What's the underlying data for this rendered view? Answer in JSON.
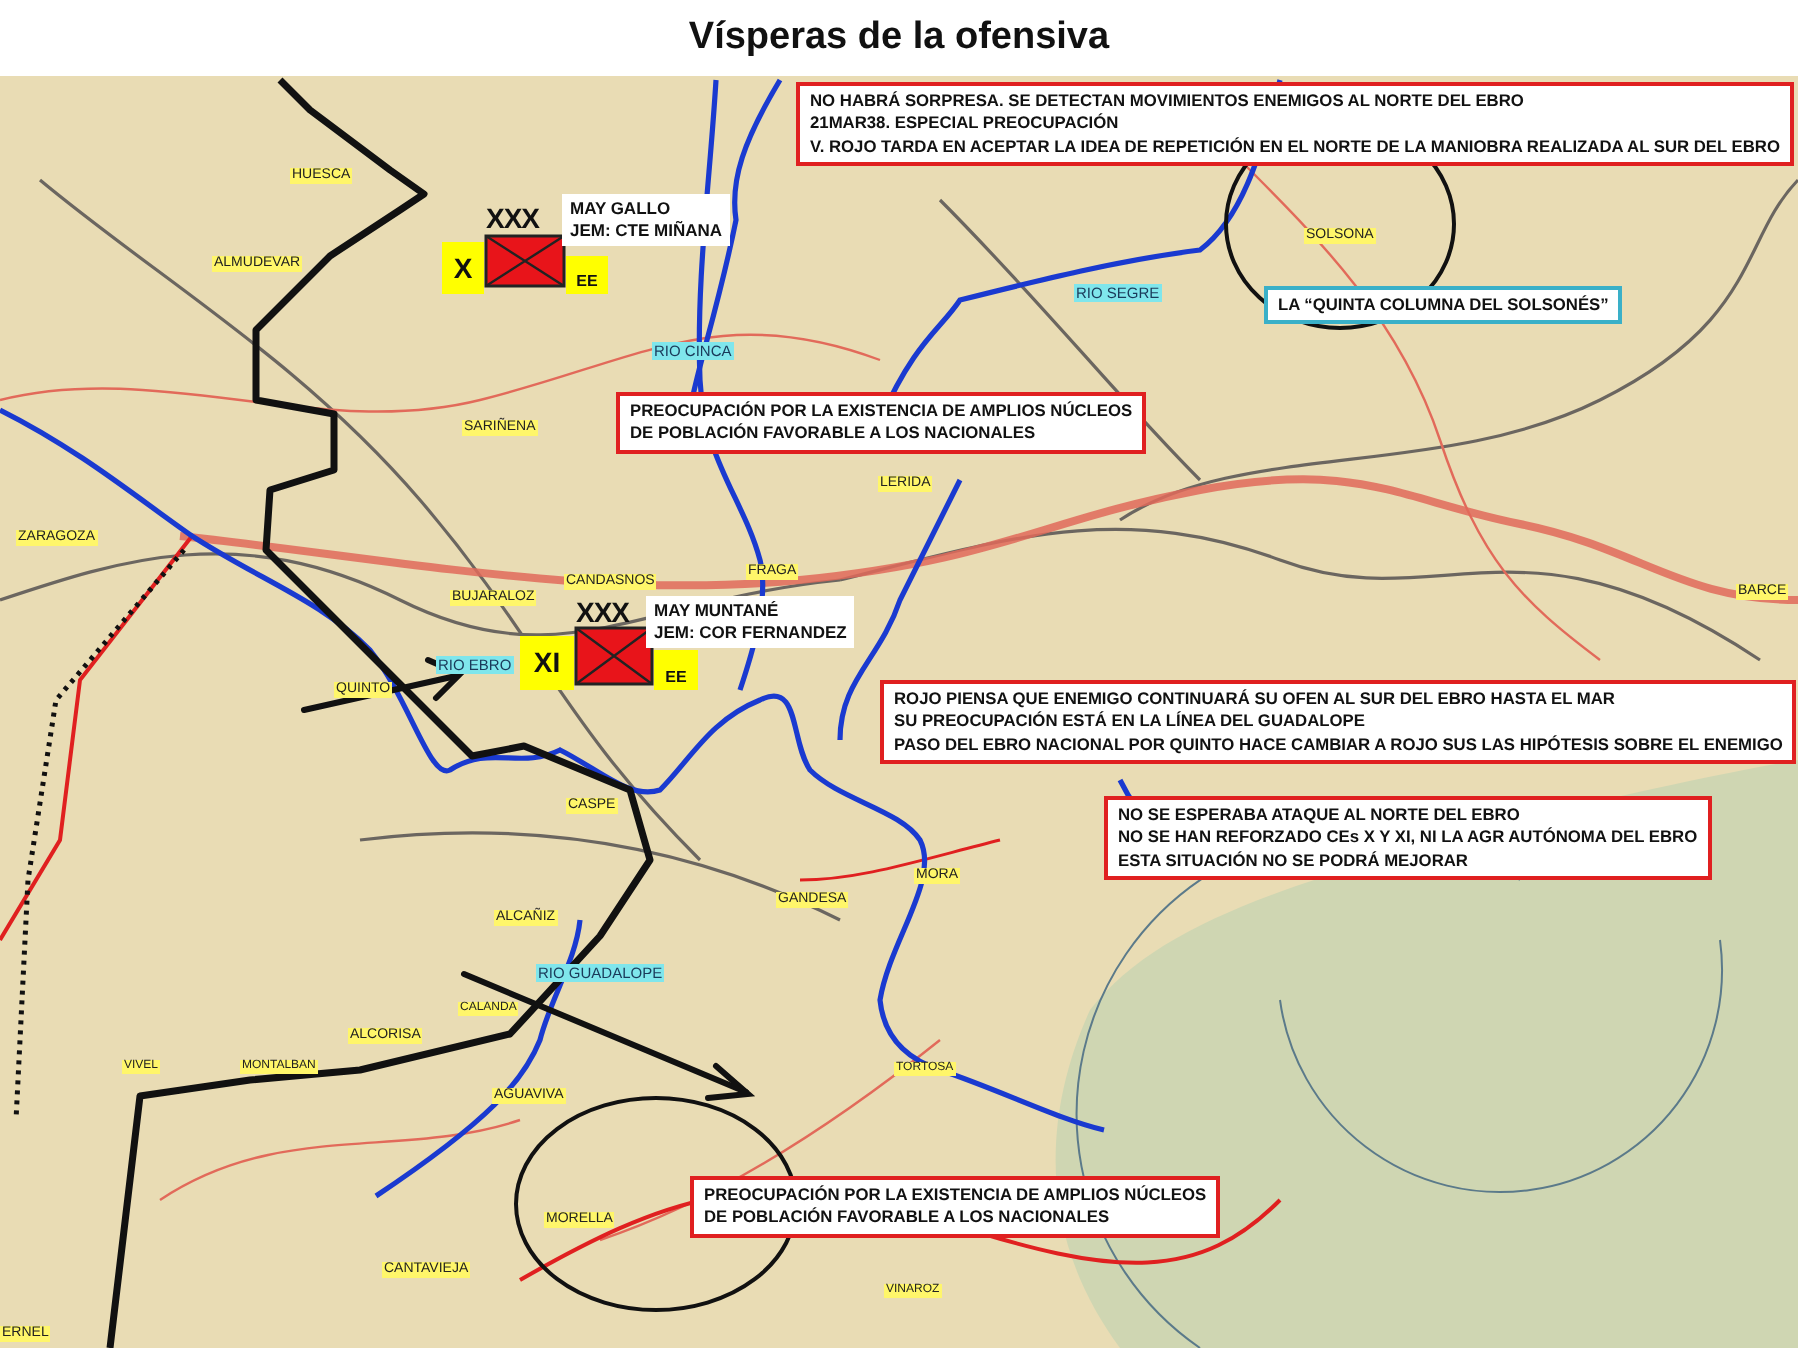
{
  "title": "Vísperas de la ofensiva",
  "place_labels": [
    "HUESCA",
    "ALMUDEVAR",
    "SARIÑENA",
    "ZARAGOZA",
    "BUJARALOZ",
    "CANDASNOS",
    "FRAGA",
    "LERIDA",
    "QUINTO",
    "CASPE",
    "ALCAÑIZ",
    "GANDESA",
    "MORA",
    "CALANDA",
    "ALCORISA",
    "VIVEL",
    "MONTALBAN",
    "AGUAVIVA",
    "MORELLA",
    "CANTAVIEJA",
    "TORTOSA",
    "VINAROZ",
    "SOLSONA",
    "BARCE",
    "ERNEL"
  ],
  "river_labels": [
    "RIO CINCA",
    "RIO SEGRE",
    "RIO EBRO",
    "RIO GUADALOPE"
  ],
  "notes": [
    {
      "color": "#e02020",
      "lines": [
        "NO HABRÁ SORPRESA. SE DETECTAN MOVIMIENTOS ENEMIGOS AL NORTE DEL EBRO",
        "21MAR38. ESPECIAL PREOCUPACIÓN",
        "V. ROJO TARDA EN ACEPTAR LA IDEA DE REPETICIÓN EN EL NORTE DE LA MANIOBRA REALIZADA AL SUR DEL EBRO"
      ]
    },
    {
      "color": "#3ab0c8",
      "lines": [
        "LA “QUINTA COLUMNA DEL SOLSONÉS”"
      ]
    },
    {
      "color": "#e02020",
      "lines": [
        "PREOCUPACIÓN POR LA EXISTENCIA DE AMPLIOS NÚCLEOS",
        "DE POBLACIÓN FAVORABLE A LOS NACIONALES"
      ]
    },
    {
      "color": "#e02020",
      "lines": [
        "ROJO PIENSA QUE ENEMIGO CONTINUARÁ SU OFEN AL SUR DEL EBRO HASTA EL MAR",
        "SU PREOCUPACIÓN ESTÁ EN LA LÍNEA DEL GUADALOPE",
        "PASO DEL EBRO NACIONAL POR QUINTO HACE CAMBIAR A ROJO SUS LAS HIPÓTESIS SOBRE EL ENEMIGO"
      ]
    },
    {
      "color": "#e02020",
      "lines": [
        "NO SE ESPERABA ATAQUE AL NORTE DEL EBRO",
        "NO SE HAN REFORZADO CEs X Y XI, NI LA AGR AUTÓNOMA DEL EBRO",
        "ESTA SITUACIÓN NO SE PODRÁ MEJORAR"
      ]
    },
    {
      "color": "#e02020",
      "lines": [
        "PREOCUPACIÓN POR LA EXISTENCIA DE AMPLIOS NÚCLEOS",
        "DE POBLACIÓN FAVORABLE A LOS NACIONALES"
      ]
    }
  ],
  "units": [
    {
      "echelon": "XXX",
      "designation": "X",
      "suffix": "EE",
      "commander_lines": [
        "MAY GALLO",
        "JEM: CTE MIÑANA"
      ]
    },
    {
      "echelon": "XXX",
      "designation": "XI",
      "suffix": "EE",
      "commander_lines": [
        "MAY MUNTANÉ",
        "JEM: COR FERNANDEZ"
      ]
    }
  ]
}
